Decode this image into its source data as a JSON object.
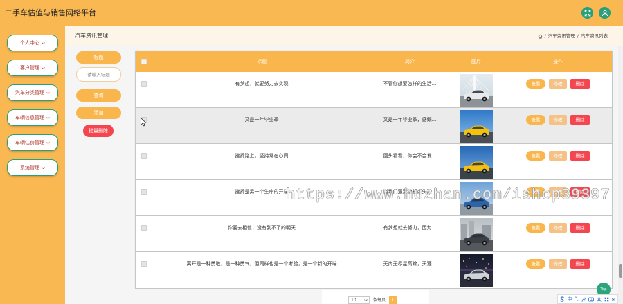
{
  "app": {
    "title": "二手车估值与销售网络平台"
  },
  "header": {
    "fullscreen_icon": "fullscreen-icon",
    "user_icon": "user-icon"
  },
  "sidebar": {
    "chevron_icon": "chevron-down-icon",
    "items": [
      {
        "label": "个人中心"
      },
      {
        "label": "客户管理"
      },
      {
        "label": "汽车分类管理"
      },
      {
        "label": "车辆信息管理"
      },
      {
        "label": "车辆估价管理"
      },
      {
        "label": "系统管理"
      }
    ]
  },
  "breadcrumb": {
    "page_title": "汽车资讯管理",
    "home_icon": "home-icon",
    "separator": "/",
    "trail": [
      "汽车资讯管理",
      "汽车资讯列表"
    ]
  },
  "search": {
    "field_label": "标题",
    "input_value": "",
    "input_placeholder": "请输入标题",
    "query_button": "查询",
    "add_button": "添加",
    "batch_delete_button": "批量删除"
  },
  "table": {
    "columns": [
      "标题",
      "简介",
      "图片",
      "操作"
    ],
    "actions": {
      "view": "查看",
      "edit": "修改",
      "delete": "删除"
    },
    "rows": [
      {
        "title": "有梦想，就要努力去实现",
        "intro": "不管你想要怎样的生活...",
        "hovered": false,
        "photo": {
          "sky": "#e4ecf1",
          "sky_low": "#c9d4dc",
          "ground": "#8c9296",
          "car": "#e8e9eb"
        }
      },
      {
        "title": "又是一年毕业季",
        "intro": "又是一年毕业季，感慨...",
        "hovered": true,
        "photo": {
          "sky": "#2f79c9",
          "sky_low": "#8ec0e8",
          "ground": "#4a4f55",
          "car": "#f4c20d"
        }
      },
      {
        "title": "挫折路上，坚持常在心间",
        "intro": "回头看看，你会不会发...",
        "hovered": false,
        "photo": {
          "sky": "#2566b5",
          "sky_low": "#7fb1e3",
          "ground": "#3a434c",
          "car": "#f2bf12"
        }
      },
      {
        "title": "挫折是另一个生命的开端",
        "intro": "当我们遇到挫折或失败...",
        "hovered": false,
        "photo": {
          "sky": "#6fa3d6",
          "sky_low": "#c7dcef",
          "ground": "#8f9aa3",
          "car": "#2d63a8"
        }
      },
      {
        "title": "你要去相信，没有到不了的明天",
        "intro": "有梦想就去努力，因为...",
        "hovered": false,
        "photo": {
          "sky": "#b9bec3",
          "sky_low": "#e0e3e5",
          "ground": "#55595d",
          "car": "#3b4046"
        }
      },
      {
        "title": "离开是一种勇敢，是一种勇气，但同样也是一个考验，是一个新的开端",
        "intro": "无尚无尽星高耸，天涯...",
        "hovered": false,
        "photo": {
          "sky": "#141a2a",
          "sky_low": "#3a3550",
          "ground": "#2a2d38",
          "car": "#cfd2d8"
        }
      }
    ]
  },
  "pagination": {
    "page_size": "10",
    "page_size_suffix": "条每页",
    "current_page": "1"
  },
  "back_to_top": {
    "label": "Top"
  },
  "ime_toolbar": {
    "logo_icon": "sogou-logo-icon",
    "mode": "中",
    "punctuation": "°,",
    "icons": [
      "pencil-icon",
      "keyboard-icon",
      "user-icon",
      "grid-icon",
      "gear-icon"
    ]
  },
  "watermark": {
    "text": "https://www.huzhan.com/ishop39397"
  },
  "theme": {
    "header_bg": "#f9b852",
    "primary": "#f9b64d",
    "green": "#2a9f78",
    "danger": "#f3464f",
    "edit": "#f4c287",
    "menu_text": "#b23a2e",
    "crumb_bg": "#fdf5e8"
  }
}
